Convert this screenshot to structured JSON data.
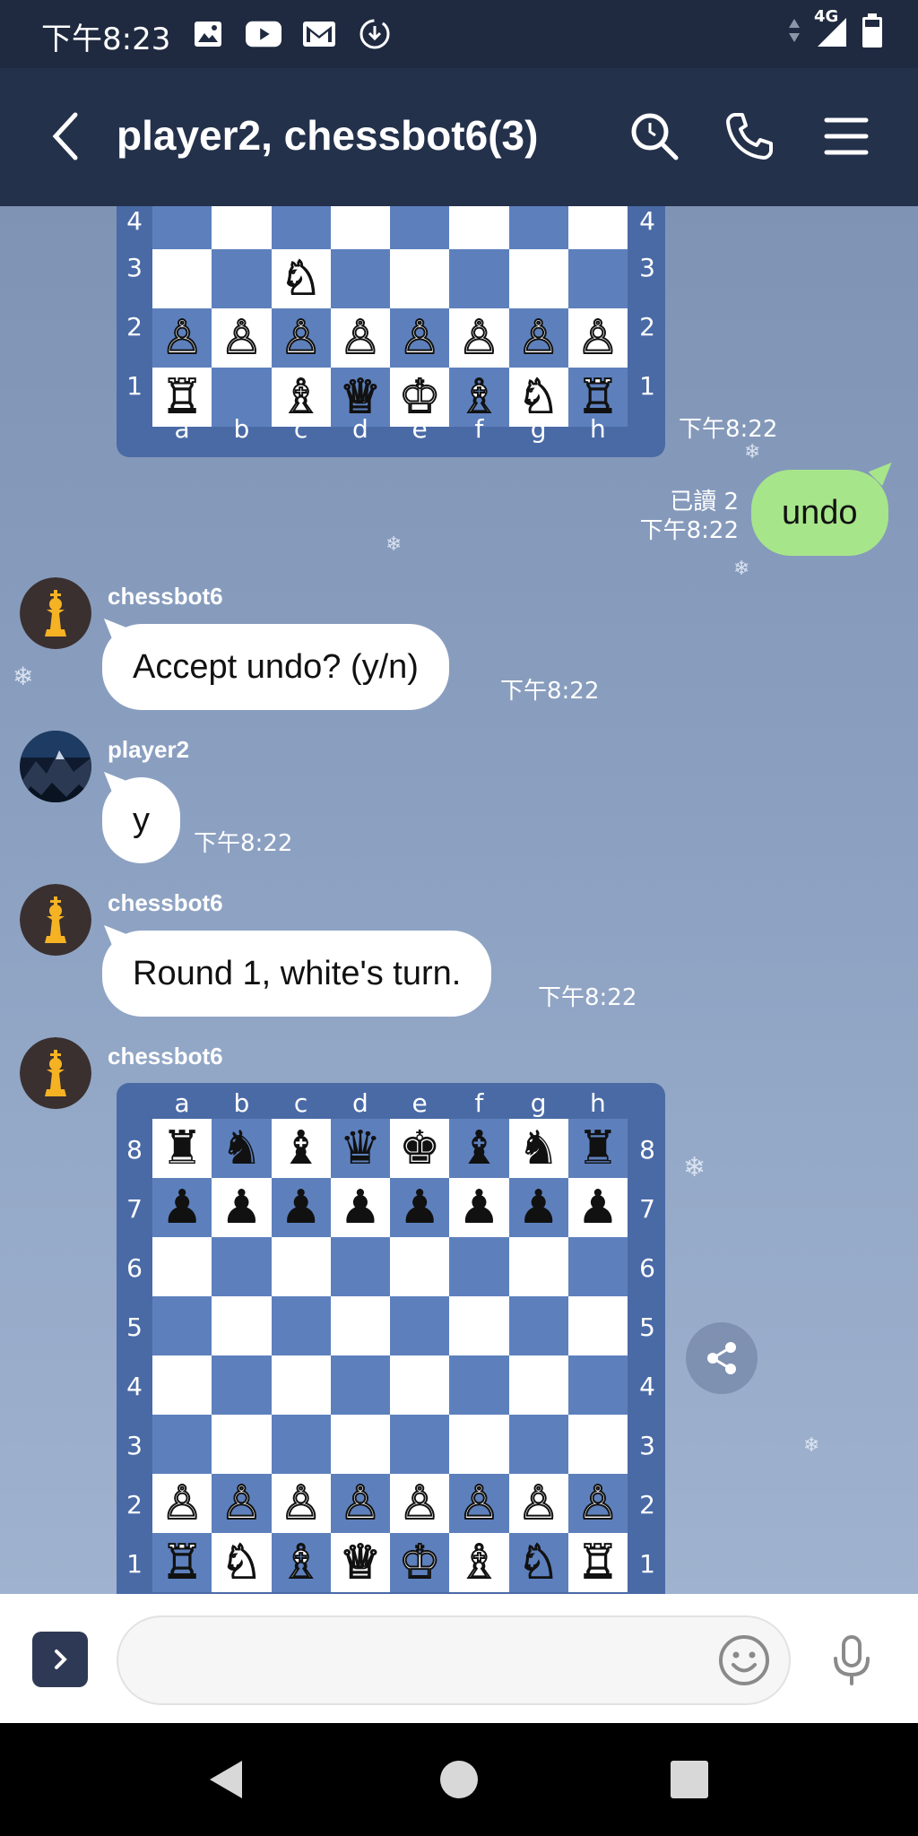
{
  "status_bar": {
    "time": "下午8:23",
    "icons": [
      "image-icon",
      "youtube-icon",
      "gmail-icon",
      "download-icon"
    ],
    "network": "4G",
    "signal": "signal-icon",
    "battery": "battery-icon"
  },
  "header": {
    "title": "player2, chessbot6(3)",
    "back_icon": "chevron-left-icon",
    "actions": [
      "search-icon",
      "phone-icon",
      "menu-icon"
    ]
  },
  "board_top": {
    "ranks": [
      "4",
      "3",
      "2",
      "1"
    ],
    "files": [
      "a",
      "b",
      "c",
      "d",
      "e",
      "f",
      "g",
      "h"
    ],
    "rows": [
      [
        "",
        "",
        "",
        "",
        "",
        "",
        "",
        ""
      ],
      [
        "",
        "",
        "♘",
        "",
        "",
        "",
        "",
        ""
      ],
      [
        "♙",
        "♙",
        "♙",
        "♙",
        "♙",
        "♙",
        "♙",
        "♙"
      ],
      [
        "♖",
        "",
        "♗",
        "♕",
        "♔",
        "♗",
        "♘",
        "♖"
      ]
    ],
    "timestamp": "下午8:22"
  },
  "messages": {
    "undo": {
      "text": "undo",
      "read": "已讀 2",
      "time": "下午8:22"
    },
    "accept": {
      "sender": "chessbot6",
      "text": "Accept undo? (y/n)",
      "time": "下午8:22"
    },
    "yes": {
      "sender": "player2",
      "text": "y",
      "time": "下午8:22"
    },
    "round": {
      "sender": "chessbot6",
      "text": "Round 1, white's turn.",
      "time": "下午8:22"
    },
    "board_sender": "chessbot6"
  },
  "board_bottom": {
    "ranks": [
      "8",
      "7",
      "6",
      "5",
      "4",
      "3",
      "2",
      "1"
    ],
    "files": [
      "a",
      "b",
      "c",
      "d",
      "e",
      "f",
      "g",
      "h"
    ],
    "rows": [
      [
        "♜",
        "♞",
        "♝",
        "♛",
        "♚",
        "♝",
        "♞",
        "♜"
      ],
      [
        "♟",
        "♟",
        "♟",
        "♟",
        "♟",
        "♟",
        "♟",
        "♟"
      ],
      [
        "",
        "",
        "",
        "",
        "",
        "",
        "",
        ""
      ],
      [
        "",
        "",
        "",
        "",
        "",
        "",
        "",
        ""
      ],
      [
        "",
        "",
        "",
        "",
        "",
        "",
        "",
        ""
      ],
      [
        "",
        "",
        "",
        "",
        "",
        "",
        "",
        ""
      ],
      [
        "♙",
        "♙",
        "♙",
        "♙",
        "♙",
        "♙",
        "♙",
        "♙"
      ],
      [
        "♖",
        "♘",
        "♗",
        "♕",
        "♔",
        "♗",
        "♘",
        "♖"
      ]
    ]
  },
  "input": {
    "placeholder": "",
    "expand_icon": "chevron-right-icon",
    "emoji_icon": "emoji-icon",
    "mic_icon": "microphone-icon"
  },
  "nav": [
    "back-triangle-icon",
    "home-circle-icon",
    "recents-square-icon"
  ]
}
